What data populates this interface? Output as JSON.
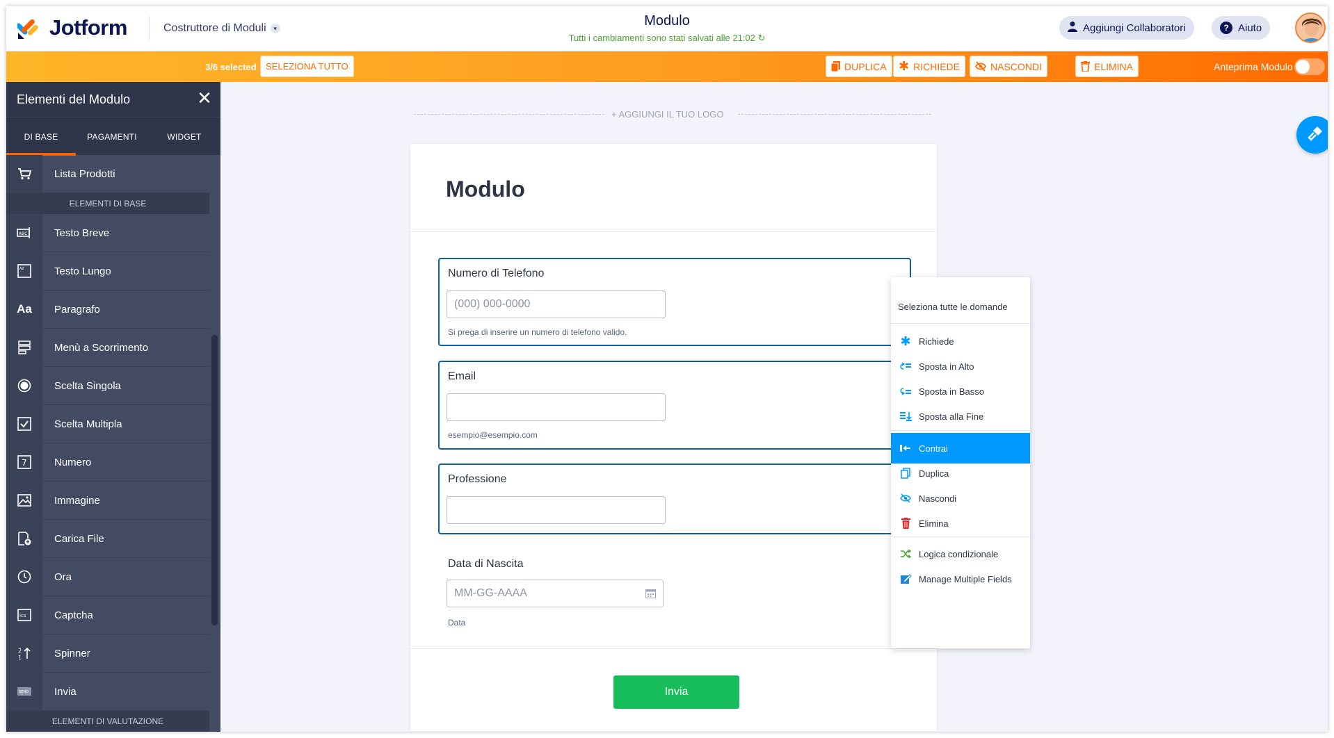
{
  "header": {
    "brand": "Jotform",
    "builder_label": "Costruttore di Moduli",
    "form_title": "Modulo",
    "save_status": "Tutti i cambiamenti sono stati salvati alle 21:02",
    "collaborators_label": "Aggiungi Collaboratori",
    "help_label": "Aiuto",
    "help_icon": "?"
  },
  "selection_bar": {
    "count": "3/6 selected",
    "select_all": "SELEZIONA TUTTO",
    "duplicate": "DUPLICA",
    "required": "RICHIEDE",
    "hide": "NASCONDI",
    "delete": "ELIMINA",
    "preview_label": "Anteprima Modulo",
    "preview_on": false
  },
  "sidebar": {
    "title": "Elementi del Modulo",
    "tabs": [
      "DI BASE",
      "PAGAMENTI",
      "WIDGET"
    ],
    "top_item": "Lista Prodotti",
    "section_basic": "ELEMENTI DI BASE",
    "items": [
      {
        "label": "Testo Breve",
        "icon": "short-text-icon"
      },
      {
        "label": "Testo Lungo",
        "icon": "long-text-icon"
      },
      {
        "label": "Paragrafo",
        "icon": "paragraph-icon"
      },
      {
        "label": "Menù a Scorrimento",
        "icon": "dropdown-icon"
      },
      {
        "label": "Scelta Singola",
        "icon": "radio-icon"
      },
      {
        "label": "Scelta Multipla",
        "icon": "checkbox-icon"
      },
      {
        "label": "Numero",
        "icon": "number-icon"
      },
      {
        "label": "Immagine",
        "icon": "image-icon"
      },
      {
        "label": "Carica File",
        "icon": "file-upload-icon"
      },
      {
        "label": "Ora",
        "icon": "clock-icon"
      },
      {
        "label": "Captcha",
        "icon": "captcha-icon"
      },
      {
        "label": "Spinner",
        "icon": "spinner-icon"
      },
      {
        "label": "Invia",
        "icon": "submit-icon"
      }
    ],
    "section_rating": "ELEMENTI DI VALUTAZIONE"
  },
  "canvas": {
    "add_logo": "+ AGGIUNGI IL TUO LOGO",
    "form_heading": "Modulo",
    "questions": [
      {
        "label": "Numero di Telefono",
        "placeholder": "(000) 000-0000",
        "sublabel": "Si prega di inserire un numero di telefono valido."
      },
      {
        "label": "Email",
        "placeholder": "",
        "sublabel": "esempio@esempio.com"
      },
      {
        "label": "Professione",
        "placeholder": "",
        "sublabel": ""
      },
      {
        "label": "Data di Nascita",
        "placeholder": "MM-GG-AAAA",
        "sublabel": "Data"
      }
    ],
    "submit_label": "Invia"
  },
  "context_menu": {
    "select_all": "Seleziona tutte le domande",
    "items": [
      {
        "label": "Richiede",
        "icon": "asterisk-icon"
      },
      {
        "label": "Sposta in Alto",
        "icon": "move-up-icon"
      },
      {
        "label": "Sposta in Basso",
        "icon": "move-down-icon"
      },
      {
        "label": "Sposta alla Fine",
        "icon": "move-end-icon"
      },
      {
        "label": "Contrai",
        "icon": "collapse-icon"
      },
      {
        "label": "Duplica",
        "icon": "duplicate-icon"
      },
      {
        "label": "Nascondi",
        "icon": "hide-icon"
      },
      {
        "label": "Elimina",
        "icon": "trash-icon"
      },
      {
        "label": "Logica condizionale",
        "icon": "conditional-logic-icon"
      },
      {
        "label": "Manage Multiple Fields",
        "icon": "manage-fields-icon"
      }
    ],
    "active_item": "Contrai"
  },
  "colors": {
    "accent_orange": "#ff6100",
    "accent_blue": "#0099ff",
    "submit_green": "#18bd5b",
    "sidebar_bg": "#424b61"
  }
}
